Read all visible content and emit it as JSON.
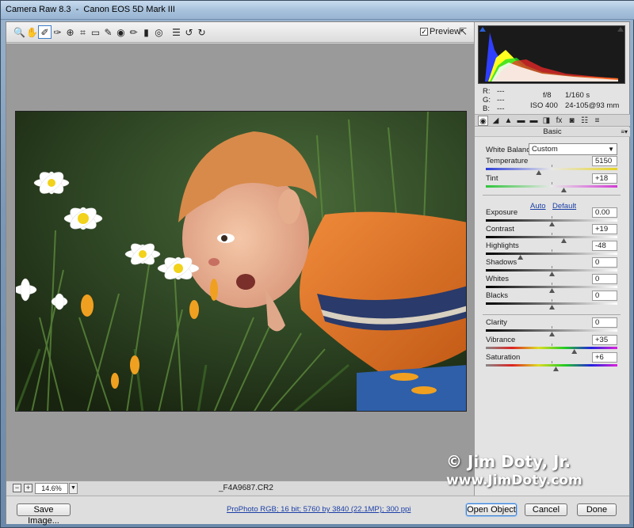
{
  "window": {
    "title": "Camera Raw 8.3  -  Canon EOS 5D Mark III"
  },
  "toolbar": {
    "tools": [
      {
        "name": "zoom-tool",
        "glyph": "🔍"
      },
      {
        "name": "hand-tool",
        "glyph": "✋"
      },
      {
        "name": "white-balance-tool",
        "glyph": "✐",
        "active": true
      },
      {
        "name": "color-sampler-tool",
        "glyph": "✑"
      },
      {
        "name": "targeted-adjustment-tool",
        "glyph": "⊕"
      },
      {
        "name": "crop-tool",
        "glyph": "⌗"
      },
      {
        "name": "straighten-tool",
        "glyph": "▭"
      },
      {
        "name": "spot-removal-tool",
        "glyph": "✎"
      },
      {
        "name": "red-eye-tool",
        "glyph": "◉"
      },
      {
        "name": "adjustment-brush-tool",
        "glyph": "✏"
      },
      {
        "name": "graduated-filter-tool",
        "glyph": "▮"
      },
      {
        "name": "radial-filter-tool",
        "glyph": "◎"
      },
      {
        "name": "preferences-tool",
        "glyph": "☰"
      },
      {
        "name": "rotate-ccw-tool",
        "glyph": "↺"
      },
      {
        "name": "rotate-cw-tool",
        "glyph": "↻"
      }
    ],
    "preview_label": "Preview",
    "preview_checked": "✓"
  },
  "zoom": {
    "minus": "−",
    "plus": "+",
    "value": "14.6%",
    "dropdown": "▼"
  },
  "filename": "_F4A9687.CR2",
  "readout": {
    "r_label": "R:",
    "r_value": "---",
    "g_label": "G:",
    "g_value": "---",
    "b_label": "B:",
    "b_value": "---",
    "aperture": "f/8",
    "shutter": "1/160 s",
    "iso": "ISO 400",
    "lens": "24-105@93 mm"
  },
  "panel": {
    "tabs": [
      "◉",
      "◢",
      "▲",
      "▬",
      "▬",
      "◨",
      "fx",
      "◙",
      "☷",
      "≡"
    ],
    "title": "Basic",
    "menu_glyph": "≡▾",
    "white_balance_label": "White Balance:",
    "white_balance_value": "Custom",
    "auto_label": "Auto",
    "default_label": "Default",
    "sliders": [
      {
        "key": "temperature",
        "label": "Temperature",
        "value": "5150",
        "pos": 0.4,
        "gradient": "linear-gradient(to right,#2c3ed6,#e8e8e8,#e6d321)"
      },
      {
        "key": "tint",
        "label": "Tint",
        "value": "+18",
        "pos": 0.59,
        "gradient": "linear-gradient(to right,#2ec43a,#e8e8e8,#d23ad4)"
      },
      {
        "key": "exposure",
        "label": "Exposure",
        "value": "0.00",
        "pos": 0.5,
        "gradient": "linear-gradient(to right,#000,#fff)"
      },
      {
        "key": "contrast",
        "label": "Contrast",
        "value": "+19",
        "pos": 0.59,
        "gradient": "linear-gradient(to right,#000,#fff)"
      },
      {
        "key": "highlights",
        "label": "Highlights",
        "value": "-48",
        "pos": 0.26,
        "gradient": "linear-gradient(to right,#000,#fff)"
      },
      {
        "key": "shadows",
        "label": "Shadows",
        "value": "0",
        "pos": 0.5,
        "gradient": "linear-gradient(to right,#000,#fff)"
      },
      {
        "key": "whites",
        "label": "Whites",
        "value": "0",
        "pos": 0.5,
        "gradient": "linear-gradient(to right,#000,#fff)"
      },
      {
        "key": "blacks",
        "label": "Blacks",
        "value": "0",
        "pos": 0.5,
        "gradient": "linear-gradient(to right,#000,#fff)"
      },
      {
        "key": "clarity",
        "label": "Clarity",
        "value": "0",
        "pos": 0.5,
        "gradient": "linear-gradient(to right,#000,#fff)"
      },
      {
        "key": "vibrance",
        "label": "Vibrance",
        "value": "+35",
        "pos": 0.67,
        "gradient": "linear-gradient(to right,#888,#d22,#dd2,#2c2,#22d,#d2d)"
      },
      {
        "key": "saturation",
        "label": "Saturation",
        "value": "+6",
        "pos": 0.53,
        "gradient": "linear-gradient(to right,#888,#d22,#dd2,#2c2,#22d,#d2d)"
      }
    ]
  },
  "bottom": {
    "save_label": "Save Image...",
    "workflow_text": "ProPhoto RGB; 16 bit; 5760 by 3840 (22.1MP); 300 ppi",
    "open_label": "Open Object",
    "cancel_label": "Cancel",
    "done_label": "Done"
  },
  "watermark": {
    "line1": "© Jim Doty, Jr.",
    "line2": "www.JimDoty.com"
  },
  "colors": {
    "accent": "#3c7fd0",
    "link": "#1b3fa6"
  }
}
